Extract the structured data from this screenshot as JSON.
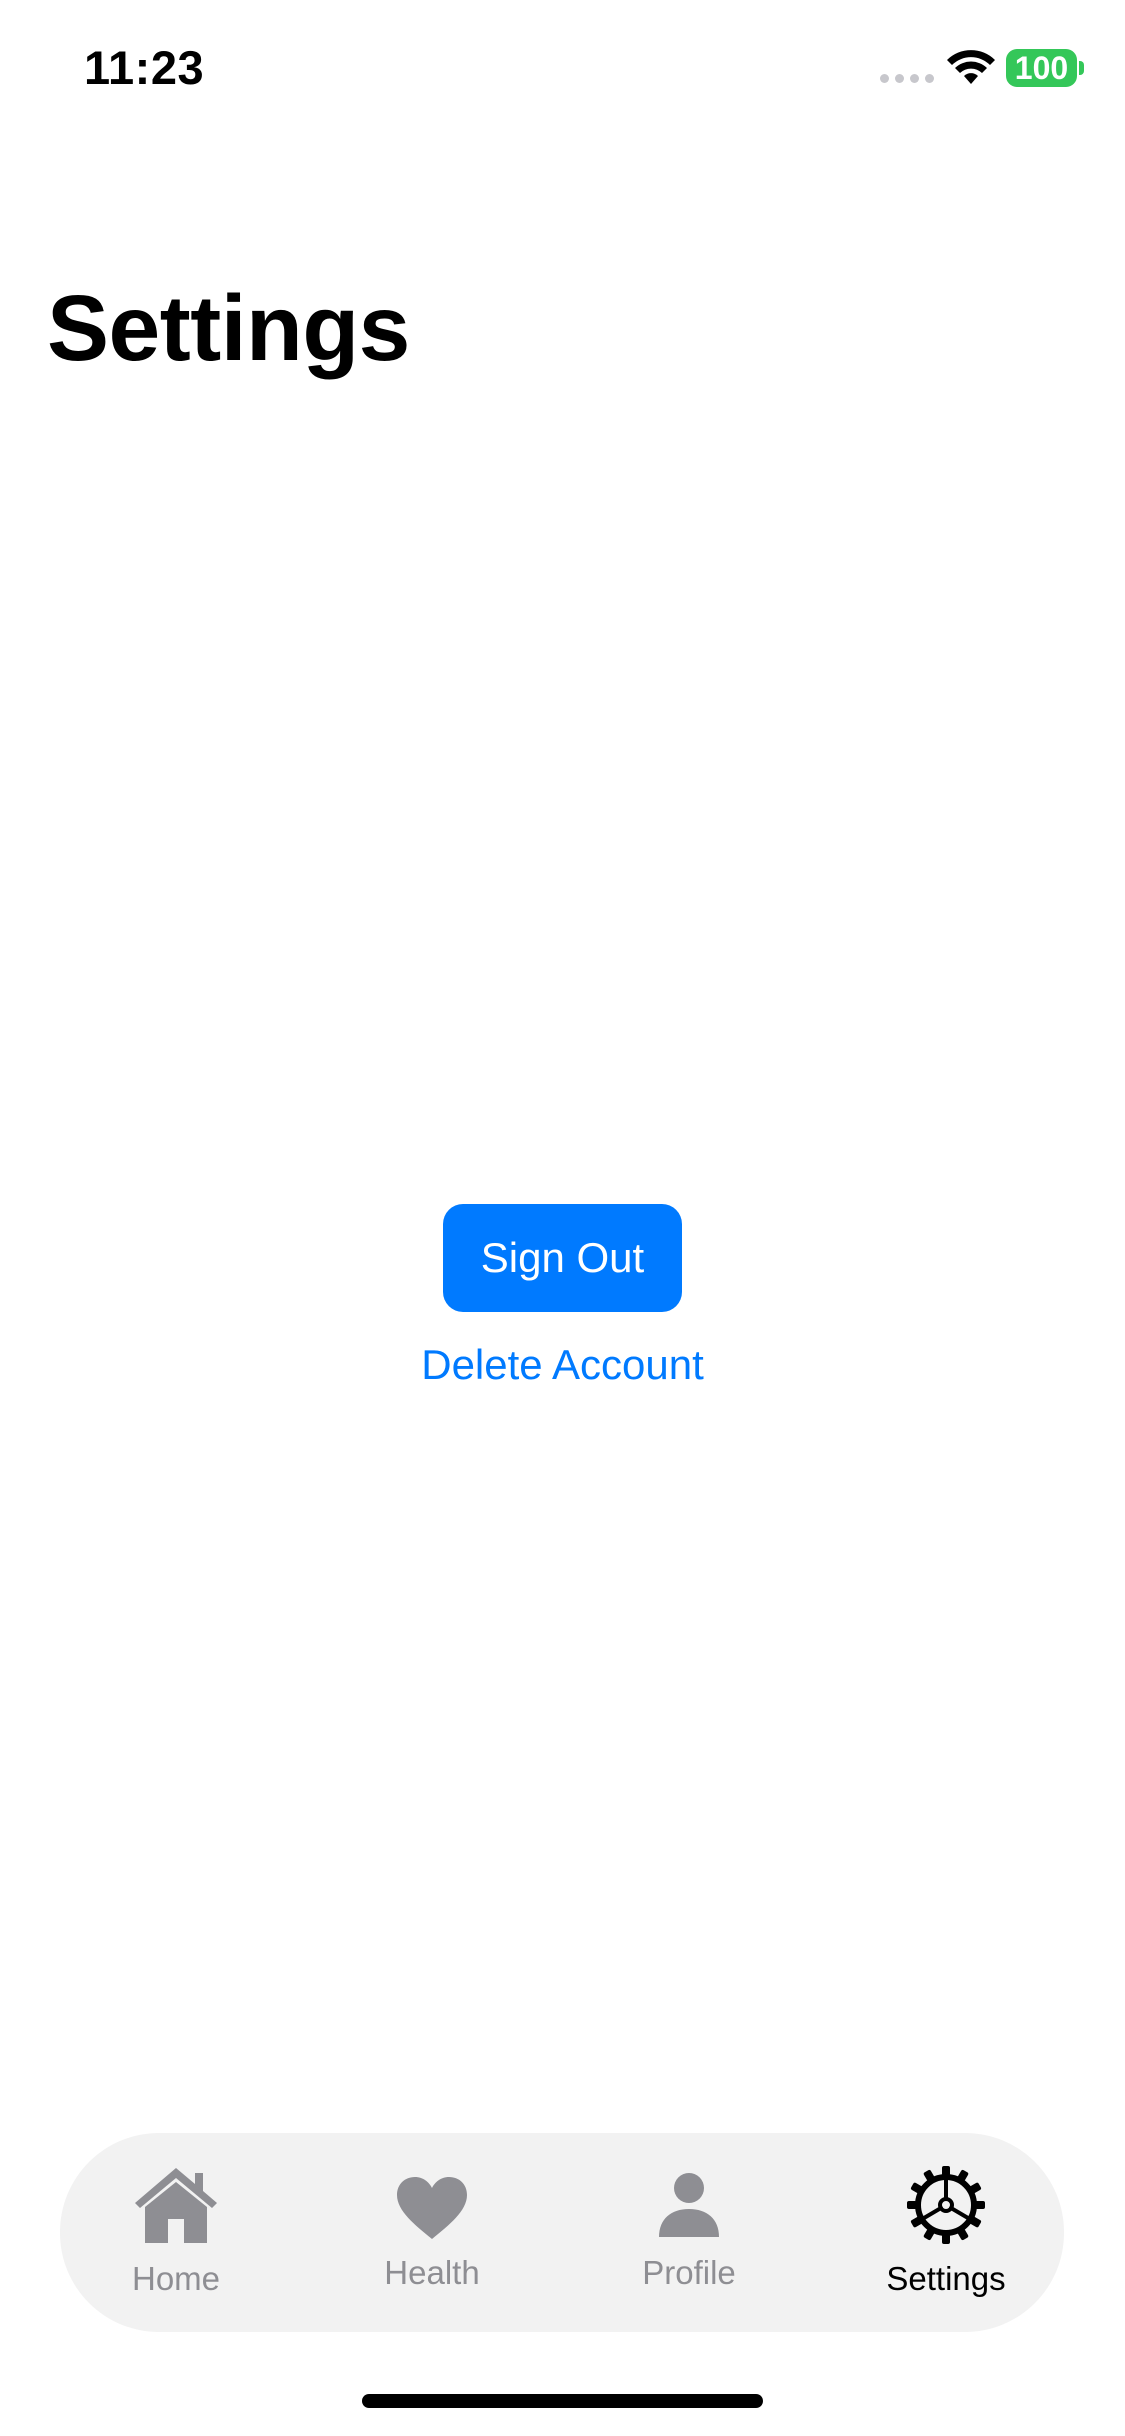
{
  "status_bar": {
    "time": "11:23",
    "battery": "100",
    "icons": [
      "signal-dots-icon",
      "wifi-icon",
      "battery-icon"
    ],
    "battery_color": "#34c759"
  },
  "page": {
    "title": "Settings"
  },
  "actions": {
    "sign_out_label": "Sign Out",
    "delete_account_label": "Delete Account",
    "accent_color": "#007aff"
  },
  "tab_bar": {
    "items": [
      {
        "label": "Home",
        "icon": "house-icon",
        "active": false
      },
      {
        "label": "Health",
        "icon": "heart-icon",
        "active": false
      },
      {
        "label": "Profile",
        "icon": "person-icon",
        "active": false
      },
      {
        "label": "Settings",
        "icon": "gear-icon",
        "active": true
      }
    ],
    "inactive_color": "#8e8e93",
    "active_color": "#000000"
  }
}
